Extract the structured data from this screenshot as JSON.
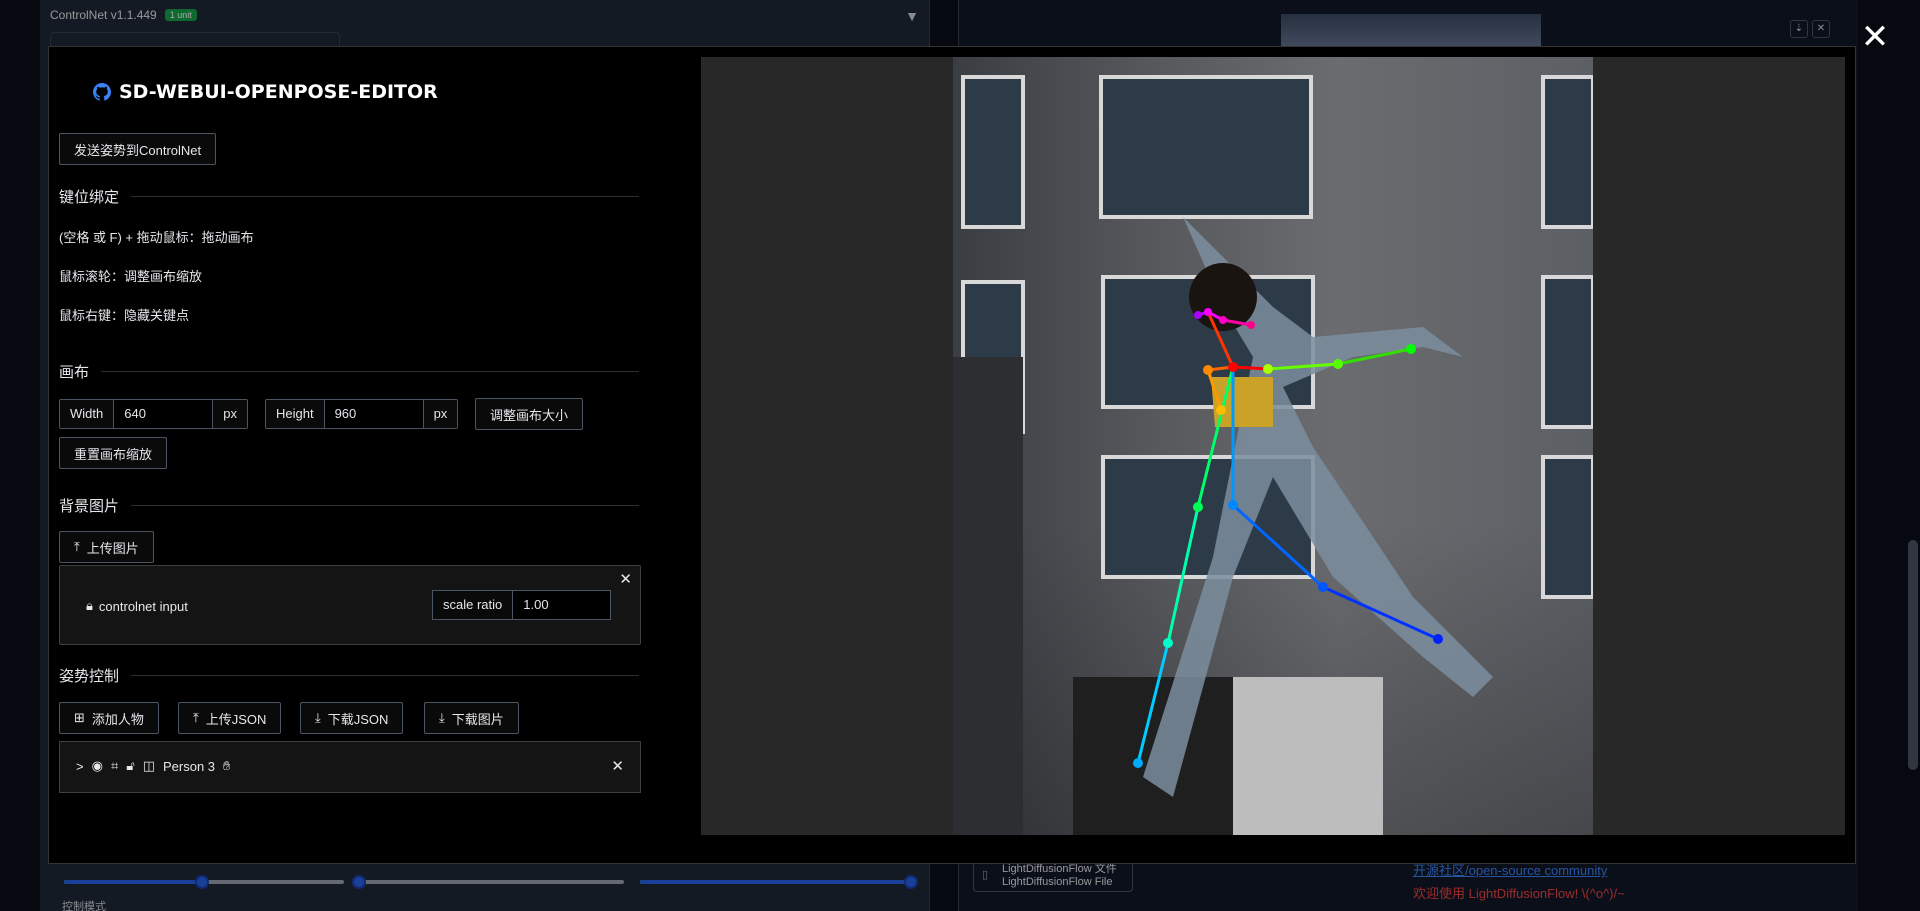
{
  "background_ui": {
    "controlnet": {
      "version": "ControlNet v1.1.449",
      "badge": "1 unit",
      "control_mode_label": "控制模式"
    },
    "lightdiffusion": {
      "file_button_line1": "LightDiffusionFlow 文件",
      "file_button_line2": "LightDiffusionFlow File",
      "community_link": "开源社区/open-source community",
      "welcome": "欢迎使用 LightDiffusionFlow! \\(^o^)/~"
    },
    "sliders": [
      {
        "value": 0.5
      },
      {
        "value": 0.0
      },
      {
        "value": 1.0
      }
    ]
  },
  "editor": {
    "title": "SD-WEBUI-OPENPOSE-EDITOR",
    "send_button": "发送姿势到ControlNet",
    "keybind": {
      "section_title": "键位绑定",
      "lines": [
        "(空格 或 F) + 拖动鼠标：拖动画布",
        "鼠标滚轮：调整画布缩放",
        "鼠标右键：隐藏关键点"
      ]
    },
    "canvas": {
      "section_title": "画布",
      "width_label": "Width",
      "width_value": "640",
      "height_label": "Height",
      "height_value": "960",
      "unit": "px",
      "resize_button": "调整画布大小",
      "reset_zoom_button": "重置画布缩放"
    },
    "background": {
      "section_title": "背景图片",
      "upload_button": "上传图片",
      "layer_label": "controlnet input",
      "scale_label": "scale ratio",
      "scale_value": "1.00"
    },
    "pose": {
      "section_title": "姿势控制",
      "add_person": "添加人物",
      "upload_json": "上传JSON",
      "download_json": "下载JSON",
      "download_image": "下载图片",
      "person_name": "Person 3"
    }
  }
}
